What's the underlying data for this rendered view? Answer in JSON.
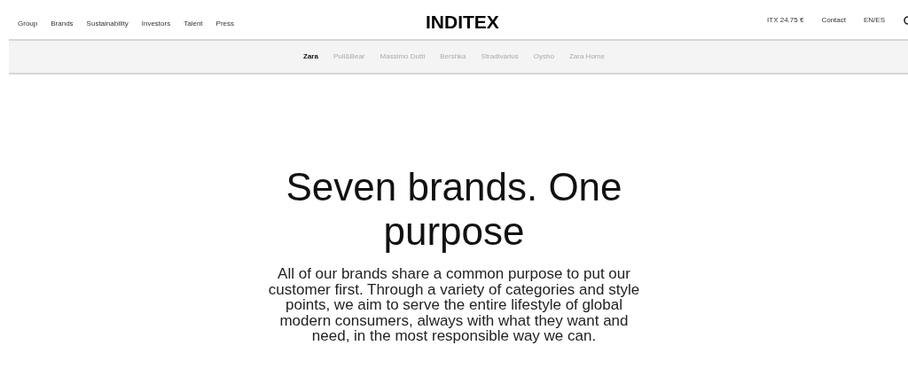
{
  "nav": {
    "links": [
      "Group",
      "Brands",
      "Sustainability",
      "Investors",
      "Talent",
      "Press"
    ],
    "logo": "INDITEX",
    "stock": "ITX 24.75 €",
    "contact": "Contact",
    "language": "EN/ES"
  },
  "brand_tabs": [
    {
      "label": "Zara",
      "selected": true
    },
    {
      "label": "Pull&Bear",
      "selected": false
    },
    {
      "label": "Massimo Dutti",
      "selected": false
    },
    {
      "label": "Bershka",
      "selected": false
    },
    {
      "label": "Stradivarius",
      "selected": false
    },
    {
      "label": "Oysho",
      "selected": false
    },
    {
      "label": "Zara Home",
      "selected": false
    }
  ],
  "hero": {
    "heading": "Seven brands. One purpose",
    "body": "All of our brands share a common purpose to put our customer first. Through a variety of categories and style points, we aim to serve the entire lifestyle of global modern consumers, always with what they want and need, in the most responsible way we can."
  }
}
